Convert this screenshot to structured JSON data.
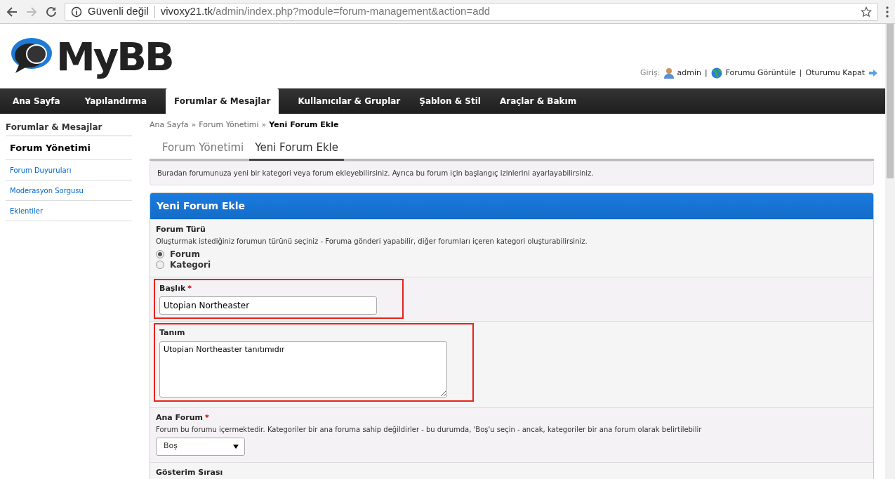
{
  "browser": {
    "security": "Güvenli değil",
    "host": "vivoxy21.tk",
    "path": "/admin/index.php?module=forum-management&action=add"
  },
  "logo": {
    "text": "MyBB"
  },
  "user_bar": {
    "label": "Giriş:",
    "items": [
      {
        "kind": "user",
        "text": "admin"
      },
      {
        "kind": "separator",
        "text": "|"
      },
      {
        "kind": "view",
        "text": "Forumu Görüntüle"
      },
      {
        "kind": "separator",
        "text": "|"
      },
      {
        "kind": "logout",
        "text": "Oturumu Kapat"
      }
    ]
  },
  "nav_tabs": [
    {
      "label": "Ana Sayfa",
      "selected": false
    },
    {
      "label": "Yapılandırma",
      "selected": false
    },
    {
      "label": "Forumlar & Mesajlar",
      "selected": true
    },
    {
      "label": "Kullanıcılar & Gruplar",
      "selected": false
    },
    {
      "label": "Şablon & Stil",
      "selected": false
    },
    {
      "label": "Araçlar & Bakım",
      "selected": false
    }
  ],
  "sidebar": {
    "title": "Forumlar & Mesajlar",
    "items": [
      {
        "label": "Forum Yönetimi",
        "selected": true
      },
      {
        "label": "Forum Duyuruları",
        "selected": false
      },
      {
        "label": "Moderasyon Sorgusu",
        "selected": false
      },
      {
        "label": "Eklentiler",
        "selected": false
      }
    ]
  },
  "breadcrumb": {
    "separator": "»",
    "items": [
      "Ana Sayfa",
      "Forum Yönetimi",
      "Yeni Forum Ekle"
    ]
  },
  "sub_tabs": [
    {
      "label": "Forum Yönetimi",
      "selected": false
    },
    {
      "label": "Yeni Forum Ekle",
      "selected": true
    }
  ],
  "description": "Buradan forumunuza yeni bir kategori veya forum ekleyebilirsiniz. Ayrıca bu forum için başlangıç izinlerini ayarlayabilirsiniz.",
  "form": {
    "title": "Yeni Forum Ekle",
    "rows": [
      {
        "kind": "radio",
        "label": "Forum Türü",
        "description": "Oluşturmak istediğiniz forumun türünü seçiniz - Foruma gönderi yapabilir, diğer forumları içeren kategori oluşturabilirsiniz.",
        "highlighted": false,
        "options": [
          {
            "label": "Forum",
            "selected": true
          },
          {
            "label": "Kategori",
            "selected": false
          }
        ]
      },
      {
        "kind": "text",
        "label": "Başlık",
        "required_mark": "*",
        "value": "Utopian Northeaster",
        "highlighted": true
      },
      {
        "kind": "textarea",
        "label": "Tanım",
        "value": "Utopian Northeaster tanıtımıdır",
        "highlighted": true
      },
      {
        "kind": "select",
        "label": "Ana Forum",
        "required_mark": "*",
        "description": "Forum bu forumu içermektedir. Kategoriler bir ana foruma sahip değildirler - bu durumda, 'Boş'u seçin - ancak, kategoriler bir ana forum olarak belirtilebilir",
        "value": "Boş",
        "highlighted": false
      },
      {
        "kind": "heading",
        "label": "Gösterim Sırası",
        "highlighted": false
      }
    ]
  }
}
